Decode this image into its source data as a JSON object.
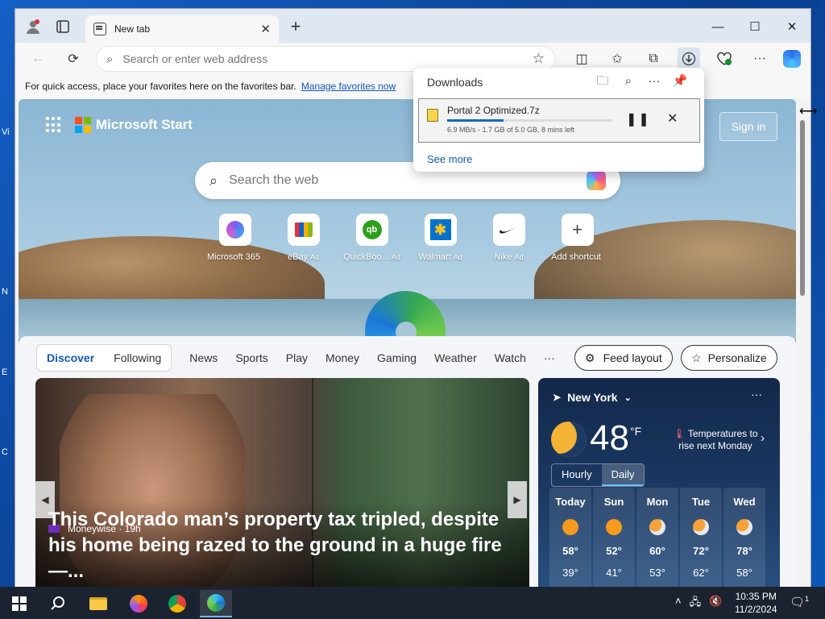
{
  "desktop": {
    "fragments": [
      "Vi",
      "N",
      "E",
      "C"
    ]
  },
  "browser": {
    "tab_title": "New tab",
    "address_placeholder": "Search or enter web address",
    "favbar_text": "For quick access, place your favorites here on the favorites bar.",
    "favbar_link": "Manage favorites now"
  },
  "start": {
    "brand": "Microsoft Start",
    "signin": "Sign in",
    "search_placeholder": "Search the web",
    "quicklinks": [
      {
        "label": "Microsoft 365",
        "ad": ""
      },
      {
        "label": "eBay",
        "ad": "Ad"
      },
      {
        "label": "QuickBoo...",
        "ad": "Ad"
      },
      {
        "label": "Walmart",
        "ad": "Ad"
      },
      {
        "label": "Nike",
        "ad": "Ad"
      },
      {
        "label": "Add shortcut",
        "ad": ""
      }
    ]
  },
  "feed": {
    "seg": [
      "Discover",
      "Following"
    ],
    "links": [
      "News",
      "Sports",
      "Play",
      "Money",
      "Gaming",
      "Weather",
      "Watch",
      "···"
    ],
    "feed_layout": "Feed layout",
    "personalize": "Personalize",
    "hero": {
      "source": "Moneywise · 19h",
      "title": "This Colorado man’s property tax tripled, despite his home being razed to the ground in a huge fire —..."
    }
  },
  "weather": {
    "location": "New York",
    "temp": "48",
    "unit": "°F",
    "note": "Temperatures to rise next Monday",
    "toggle": [
      "Hourly",
      "Daily"
    ],
    "days": [
      {
        "name": "Today",
        "hi": "58°",
        "lo": "39°",
        "icon": "sunny"
      },
      {
        "name": "Sun",
        "hi": "52°",
        "lo": "41°",
        "icon": "sunny"
      },
      {
        "name": "Mon",
        "hi": "60°",
        "lo": "53°",
        "icon": "partly-cloudy"
      },
      {
        "name": "Tue",
        "hi": "72°",
        "lo": "62°",
        "icon": "partly-cloudy"
      },
      {
        "name": "Wed",
        "hi": "78°",
        "lo": "58°",
        "icon": "partly-cloudy"
      }
    ]
  },
  "downloads": {
    "title": "Downloads",
    "file": "Portal 2 Optimized.7z",
    "progress": 0.34,
    "status": "6.9 MB/s - 1.7 GB of 5.0 GB, 8 mins left",
    "see_more": "See more"
  },
  "taskbar": {
    "time": "10:35 PM",
    "date": "11/2/2024",
    "notif_count": "1"
  }
}
